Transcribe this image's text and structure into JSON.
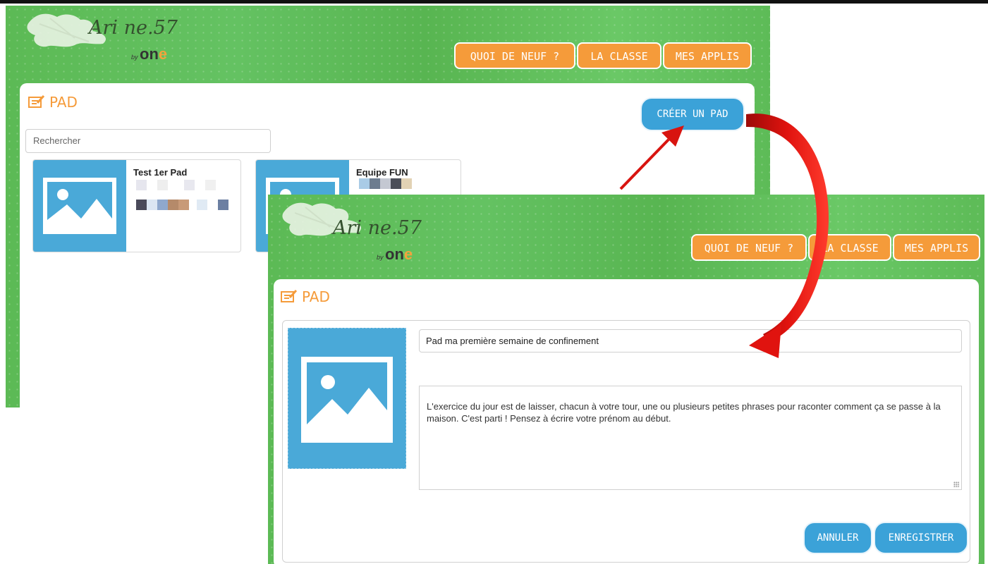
{
  "app": {
    "brand": "Ari ne.57",
    "brand_by": "by",
    "brand_one_main": "on",
    "brand_one_accent": "e",
    "accent_color": "#f59b3a",
    "button_color": "#3ba2d8",
    "header_green": "#5fbd5a"
  },
  "nav": {
    "items": [
      "QUOI DE NEUF ?",
      "LA CLASSE",
      "MES APPLIS"
    ]
  },
  "list_view": {
    "title": "PAD",
    "create_label": "CRÉER UN PAD",
    "search": {
      "value": "Rechercher"
    },
    "cards": [
      {
        "title": "Test 1er Pad",
        "icon": "image-placeholder-icon"
      },
      {
        "title": "Equipe FUN",
        "icon": "image-placeholder-icon"
      }
    ]
  },
  "edit_view": {
    "title": "PAD",
    "pad_title_value": "Pad ma première semaine de confinement",
    "description_value": "L'exercice du jour est de laisser, chacun à votre tour, une ou plusieurs petites phrases pour raconter comment ça se passe à la maison. C'est parti ! Pensez à écrire votre prénom au début.",
    "cancel_label": "ANNULER",
    "save_label": "ENREGISTRER",
    "image_icon": "image-placeholder-icon"
  },
  "annotations": {
    "arrow_color": "#e0130f",
    "arrows": [
      "straight-arrow-to-create-button",
      "curved-arrow-to-title-field"
    ]
  }
}
